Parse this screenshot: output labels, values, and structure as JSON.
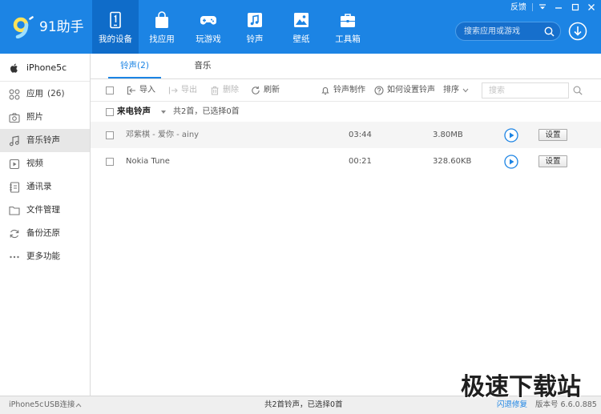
{
  "app": {
    "name": "91助手"
  },
  "window": {
    "feedback": "反馈"
  },
  "header": {
    "nav": [
      {
        "label": "我的设备",
        "icon": "device-icon",
        "active": true
      },
      {
        "label": "找应用",
        "icon": "bag-icon"
      },
      {
        "label": "玩游戏",
        "icon": "gamepad-icon"
      },
      {
        "label": "铃声",
        "icon": "music-note-icon"
      },
      {
        "label": "壁纸",
        "icon": "picture-icon"
      },
      {
        "label": "工具箱",
        "icon": "toolbox-icon"
      }
    ],
    "search": {
      "placeholder": "搜索应用或游戏"
    }
  },
  "sidebar": {
    "device": {
      "name": "iPhone5c",
      "icon": "apple-icon"
    },
    "items": [
      {
        "label": "应用",
        "count": "(26)",
        "icon": "apps-icon"
      },
      {
        "label": "照片",
        "icon": "camera-icon"
      },
      {
        "label": "音乐铃声",
        "icon": "music-icon",
        "active": true
      },
      {
        "label": "视频",
        "icon": "video-icon"
      },
      {
        "label": "通讯录",
        "icon": "contacts-icon"
      },
      {
        "label": "文件管理",
        "icon": "folder-icon"
      },
      {
        "label": "备份还原",
        "icon": "backup-icon"
      },
      {
        "label": "更多功能",
        "icon": "more-icon"
      }
    ]
  },
  "main": {
    "tabs": [
      {
        "label": "铃声(2)",
        "active": true
      },
      {
        "label": "音乐"
      }
    ],
    "toolbar": {
      "import": {
        "label": "导入",
        "icon": "import-icon"
      },
      "export": {
        "label": "导出",
        "icon": "export-icon",
        "disabled": true
      },
      "delete": {
        "label": "删除",
        "icon": "trash-icon",
        "disabled": true
      },
      "refresh": {
        "label": "刷新",
        "icon": "refresh-icon"
      },
      "make_ringtone": {
        "label": "铃声制作",
        "icon": "bell-icon"
      },
      "how_to_set": {
        "label": "如何设置铃声",
        "icon": "help-icon"
      },
      "sort": {
        "label": "排序",
        "icon": "chevron-down-icon"
      },
      "search_placeholder": "搜索"
    },
    "group": {
      "title": "来电铃声",
      "summary": "共2首，已选择0首"
    },
    "rows": [
      {
        "title": "邓紫棋 - 爱你 - ainy",
        "duration": "03:44",
        "size": "3.80MB",
        "action": "设置"
      },
      {
        "title": "Nokia Tune",
        "duration": "00:21",
        "size": "328.60KB",
        "action": "设置"
      }
    ]
  },
  "status_bar": {
    "device": "iPhone5c",
    "connection": "USB连接",
    "summary": "共2首铃声，已选择0首",
    "crash_fix": "闪退修复",
    "version": "版本号 6.6.0.885"
  },
  "watermark": "极速下载站",
  "colors": {
    "header": "#1c84e4",
    "header_active_tab": "#0f6cc9",
    "accent": "#1c84e4",
    "sidebar_active": "#e7e7e7",
    "disabled_text": "#b8b8b8",
    "status_bar": "#efefef"
  }
}
